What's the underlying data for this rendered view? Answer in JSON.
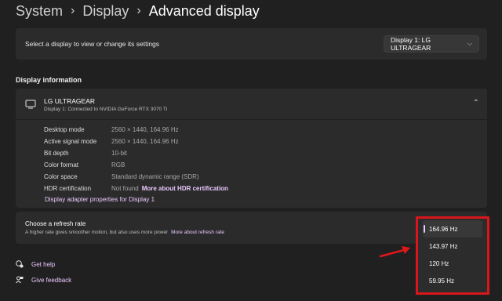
{
  "breadcrumb": {
    "items": [
      "System",
      "Display",
      "Advanced display"
    ]
  },
  "display_select": {
    "prompt": "Select a display to view or change its settings",
    "selected": "Display 1: LG ULTRAGEAR"
  },
  "display_info": {
    "heading": "Display information",
    "monitor_name": "LG ULTRAGEAR",
    "monitor_sub": "Display 1: Connected to NVIDIA GeForce RTX 3070 Ti",
    "specs": [
      {
        "label": "Desktop mode",
        "value": "2560 × 1440, 164.96 Hz"
      },
      {
        "label": "Active signal mode",
        "value": "2560 × 1440, 164.96 Hz"
      },
      {
        "label": "Bit depth",
        "value": "10-bit"
      },
      {
        "label": "Color format",
        "value": "RGB"
      },
      {
        "label": "Color space",
        "value": "Standard dynamic range (SDR)"
      },
      {
        "label": "HDR certification",
        "value": "Not found",
        "link": "More about HDR certification"
      }
    ],
    "adapter_link": "Display adapter properties for Display 1"
  },
  "refresh": {
    "title": "Choose a refresh rate",
    "description": "A higher rate gives smoother motion, but also uses more power",
    "more_link": "More about refresh rate",
    "options": [
      "164.96 Hz",
      "143.97 Hz",
      "120 Hz",
      "59.95 Hz"
    ],
    "selected": "164.96 Hz"
  },
  "footer": {
    "help": "Get help",
    "feedback": "Give feedback"
  },
  "colors": {
    "accent": "#e9c8ff",
    "highlight_box": "#d8161b",
    "background": "#202020",
    "card": "#2b2b2b"
  }
}
